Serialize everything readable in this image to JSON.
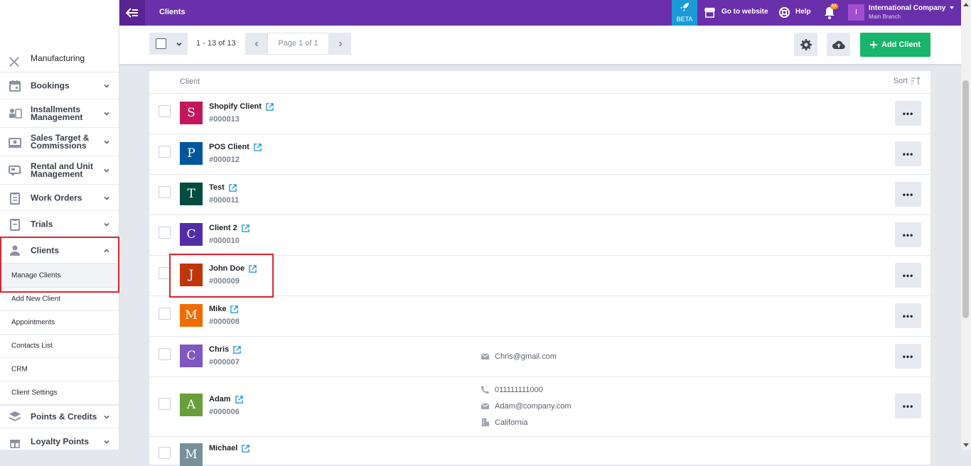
{
  "topbar": {
    "title": "Clients",
    "beta_label": "BETA",
    "website_label": "Go to website",
    "help_label": "Help",
    "notif_count": "64",
    "account_initial": "I",
    "account_name": "International Company",
    "account_branch": "Main Branch"
  },
  "sidebar": {
    "cut_item": "Manufacturing",
    "items": [
      {
        "label": "Bookings"
      },
      {
        "label": "Installments Management"
      },
      {
        "label": "Sales Target & Commissions"
      },
      {
        "label": "Rental and Unit Management"
      },
      {
        "label": "Work Orders"
      },
      {
        "label": "Trials"
      },
      {
        "label": "Clients"
      },
      {
        "label": "Points & Credits"
      },
      {
        "label": "Loyalty Points"
      }
    ],
    "subitems": [
      {
        "label": "Manage Clients"
      },
      {
        "label": "Add New Client"
      },
      {
        "label": "Appointments"
      },
      {
        "label": "Contacts List"
      },
      {
        "label": "CRM"
      },
      {
        "label": "Client Settings"
      }
    ]
  },
  "toolbar": {
    "range": "1 - 13 of 13",
    "page": "Page 1 of 1",
    "add_label": "Add Client"
  },
  "table": {
    "header": "Client",
    "sort_label": "Sort",
    "rows": [
      {
        "initial": "S",
        "name": "Shopify Client",
        "id": "#000013",
        "color": "#c2185b"
      },
      {
        "initial": "P",
        "name": "POS Client",
        "id": "#000012",
        "color": "#01579b"
      },
      {
        "initial": "T",
        "name": "Test",
        "id": "#000011",
        "color": "#004d40"
      },
      {
        "initial": "C",
        "name": "Client 2",
        "id": "#000010",
        "color": "#512da8"
      },
      {
        "initial": "J",
        "name": "John Doe",
        "id": "#000009",
        "color": "#bf360c"
      },
      {
        "initial": "M",
        "name": "Mike",
        "id": "#000008",
        "color": "#ef6c00"
      },
      {
        "initial": "C",
        "name": "Chris",
        "id": "#000007",
        "color": "#7e57c2",
        "email": "Chris@gmail.com"
      },
      {
        "initial": "A",
        "name": "Adam",
        "id": "#000006",
        "color": "#689f38",
        "phone": "011111111000",
        "email": "Adam@company.com",
        "address": "California"
      },
      {
        "initial": "M",
        "name": "Michael",
        "id": "",
        "color": "#78909c"
      }
    ]
  }
}
